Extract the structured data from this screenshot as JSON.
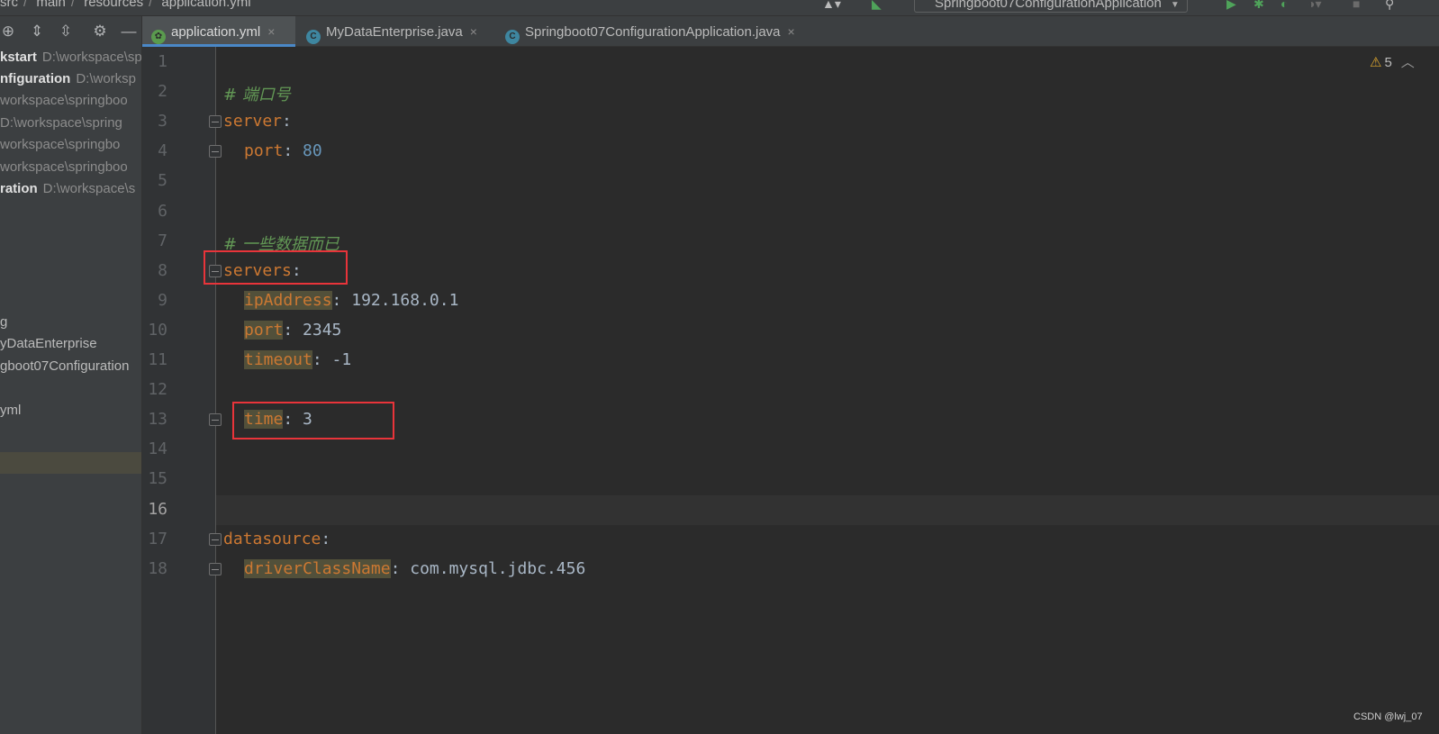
{
  "breadcrumb": [
    "src",
    "main",
    "resources",
    "application.yml"
  ],
  "run_config": "Springboot07ConfigurationApplication",
  "project_tree": [
    {
      "label": "kstart",
      "path": "D:\\workspace\\sp",
      "bold": true
    },
    {
      "label": "nfiguration",
      "path": "D:\\worksp",
      "bold": true
    },
    {
      "label": "",
      "path": "workspace\\springboo",
      "bold": false
    },
    {
      "label": "",
      "path": "D:\\workspace\\spring",
      "bold": false
    },
    {
      "label": "",
      "path": "workspace\\springbo",
      "bold": false
    },
    {
      "label": "",
      "path": "workspace\\springboo",
      "bold": false
    },
    {
      "label": "ration",
      "path": "D:\\workspace\\s",
      "bold": true
    },
    {
      "label": "g",
      "path": "",
      "bold": false
    },
    {
      "label": "yDataEnterprise",
      "path": "",
      "bold": false
    },
    {
      "label": "gboot07Configuration",
      "path": "",
      "bold": false
    },
    {
      "label": "yml",
      "path": "",
      "bold": false
    }
  ],
  "tabs": [
    {
      "label": "application.yml",
      "icon": "yml-leaf-icon",
      "active": true
    },
    {
      "label": "MyDataEnterprise.java",
      "icon": "class-icon",
      "active": false
    },
    {
      "label": "Springboot07ConfigurationApplication.java",
      "icon": "spring-class-icon",
      "active": false
    }
  ],
  "warnings_count": "5",
  "current_line": 16,
  "code_lines": [
    {
      "n": "1",
      "c": ""
    },
    {
      "n": "2",
      "c": "# 端口号"
    },
    {
      "n": "3",
      "key": "server",
      "sep": ":"
    },
    {
      "n": "4",
      "key": "port",
      "sep": ": ",
      "v": "80"
    },
    {
      "n": "5",
      "c": ""
    },
    {
      "n": "6",
      "c": ""
    },
    {
      "n": "7",
      "c": "# 一些数据而已"
    },
    {
      "n": "8",
      "key": "servers",
      "sep": ":"
    },
    {
      "n": "9",
      "key": "ipAddress",
      "sep": ": ",
      "v": "192.168.0.1"
    },
    {
      "n": "10",
      "key": "port",
      "sep": ": ",
      "v": "2345"
    },
    {
      "n": "11",
      "key": "timeout",
      "sep": ": ",
      "v": "-1"
    },
    {
      "n": "12",
      "c": ""
    },
    {
      "n": "13",
      "key": "time",
      "sep": ": ",
      "v": "3"
    },
    {
      "n": "14",
      "c": ""
    },
    {
      "n": "15",
      "c": ""
    },
    {
      "n": "16",
      "c": ""
    },
    {
      "n": "17",
      "key": "datasource",
      "sep": ":"
    },
    {
      "n": "18",
      "key": "driverClassName",
      "sep": ": ",
      "v": "com.mysql.jdbc.456"
    }
  ],
  "watermark": "CSDN @lwj_07",
  "colors": {
    "accent": "#4a88c7",
    "annotation_box": "#e8343a",
    "yaml_key": "#cc7832",
    "comment": "#629755",
    "number": "#6897bb"
  }
}
